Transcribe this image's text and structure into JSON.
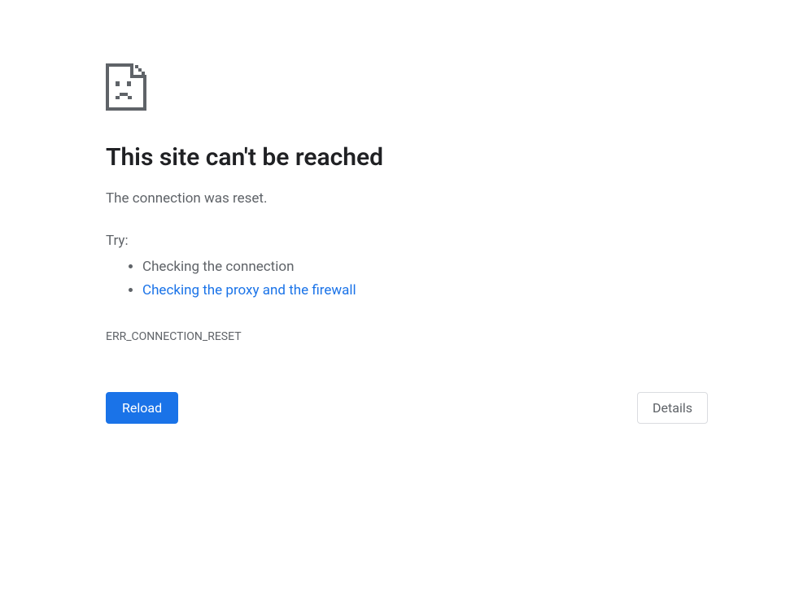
{
  "error": {
    "title": "This site can't be reached",
    "subtitle": "The connection was reset.",
    "try_label": "Try:",
    "suggestions": {
      "check_connection": "Checking the connection",
      "check_proxy_firewall": "Checking the proxy and the firewall"
    },
    "code": "ERR_CONNECTION_RESET"
  },
  "buttons": {
    "reload": "Reload",
    "details": "Details"
  }
}
